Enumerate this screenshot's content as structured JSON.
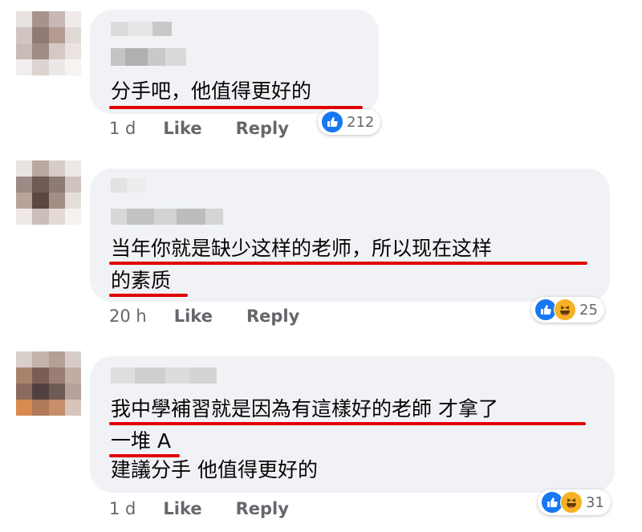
{
  "comments": [
    {
      "text_lines": [
        "分手吧，他值得更好的"
      ],
      "time": "1 d",
      "like_label": "Like",
      "reply_label": "Reply",
      "reactions": [
        "like-icon"
      ],
      "reaction_count": "212"
    },
    {
      "text_lines": [
        "当年你就是缺少这样的老师，所以现在这样",
        "的素质"
      ],
      "time": "20 h",
      "like_label": "Like",
      "reply_label": "Reply",
      "reactions": [
        "like-icon",
        "haha-icon"
      ],
      "reaction_count": "25"
    },
    {
      "text_lines": [
        "我中學補習就是因為有這樣好的老師 才拿了",
        "一堆 A",
        "建議分手 他值得更好的"
      ],
      "time": "1 d",
      "like_label": "Like",
      "reply_label": "Reply",
      "reactions": [
        "like-icon",
        "haha-icon"
      ],
      "reaction_count": "31"
    }
  ],
  "colors": {
    "bubble": "#f0f2f5",
    "text": "#050505",
    "meta": "#65676b",
    "underline": "#e00000",
    "like": "#1877f2",
    "haha": "#f7b125"
  }
}
